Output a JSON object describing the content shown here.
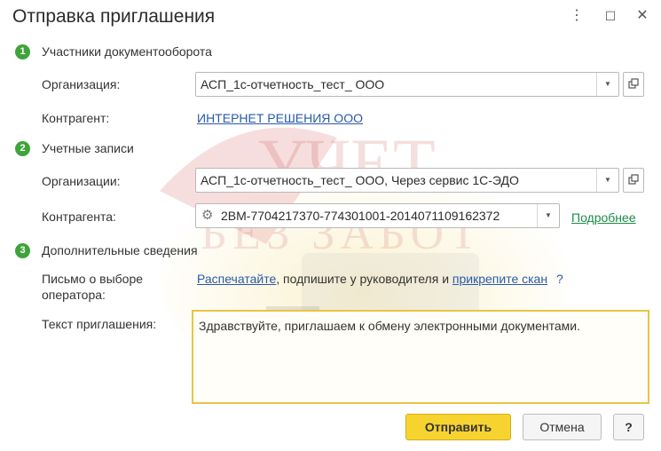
{
  "window": {
    "title": "Отправка приглашения",
    "more_glyph": "⋮",
    "maximize_glyph": "☐",
    "close_glyph": "✕"
  },
  "section1": {
    "number": "1",
    "title": "Участники документооборота",
    "org_label": "Организация:",
    "org_value": "АСП_1с-отчетность_тест_ ООО",
    "contractor_label": "Контрагент:",
    "contractor_link": "ИНТЕРНЕТ РЕШЕНИЯ ООО"
  },
  "section2": {
    "number": "2",
    "title": "Учетные записи",
    "orgs_label": "Организации:",
    "orgs_value": "АСП_1с-отчетность_тест_ ООО, Через сервис 1С-ЭДО",
    "contractors_label": "Контрагента:",
    "contractors_value": "2BM-7704217370-774301001-2014071109162372",
    "more_link": "Подробнее"
  },
  "section3": {
    "number": "3",
    "title": "Дополнительные сведения",
    "letter_label": "Письмо о выборе оператора:",
    "print_link": "Распечатайте",
    "middle_text": ", подпишите у руководителя и",
    "attach_link": "прикрепите скан",
    "help_glyph": "?",
    "text_label": "Текст приглашения:",
    "text_value": "Здравствуйте, приглашаем к обмену электронными документами."
  },
  "footer": {
    "send_label": "Отправить",
    "cancel_label": "Отмена",
    "help_label": "?"
  },
  "watermark": {
    "line1": "УЧЕТ",
    "line2": "БЕЗ ЗАБОТ"
  },
  "colors": {
    "step_green": "#3fa33a",
    "link_blue": "#2a5aa8",
    "primary_yellow": "#f7d330",
    "memo_border": "#e8c544"
  }
}
